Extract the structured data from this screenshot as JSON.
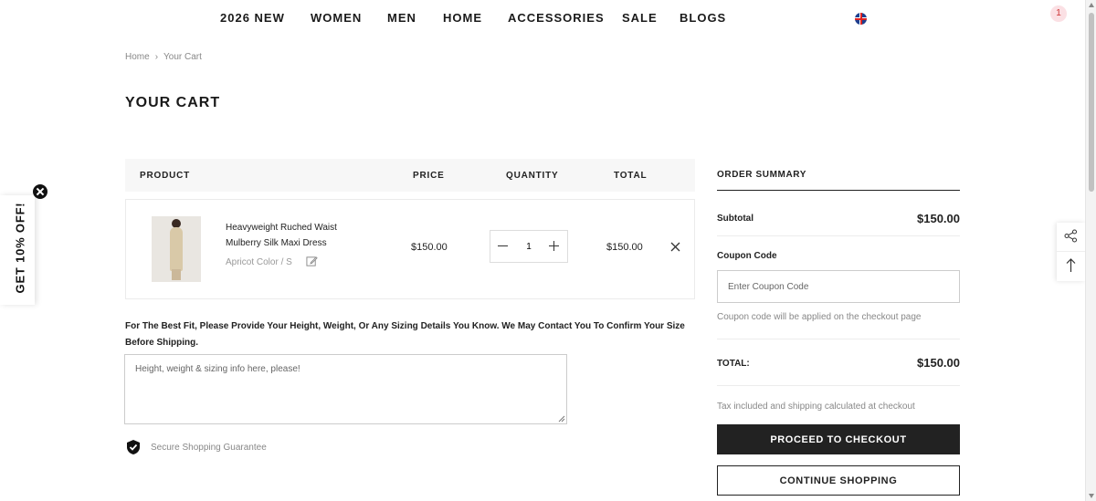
{
  "nav": {
    "items": [
      "2026 NEW",
      "WOMEN",
      "MEN",
      "HOME",
      "ACCESSORIES",
      "SALE",
      "BLOGS"
    ],
    "cart_count": "1"
  },
  "breadcrumb": {
    "home": "Home",
    "current": "Your Cart"
  },
  "page_title": "YOUR CART",
  "table": {
    "headers": {
      "product": "PRODUCT",
      "price": "PRICE",
      "quantity": "QUANTITY",
      "total": "TOTAL"
    }
  },
  "cart_item": {
    "name_line1": "Heavyweight Ruched Waist",
    "name_line2": "Mulberry Silk Maxi Dress",
    "variant": "Apricot Color / S",
    "price": "$150.00",
    "quantity": "1",
    "total": "$150.00"
  },
  "sizing": {
    "note": "For The Best Fit, Please Provide Your Height, Weight, Or Any Sizing Details You Know. We May Contact You To Confirm Your Size Before Shipping.",
    "placeholder": "Height, weight & sizing info here, please!"
  },
  "secure_text": "Secure Shopping Guarantee",
  "summary": {
    "title": "ORDER SUMMARY",
    "subtotal_label": "Subtotal",
    "subtotal_value": "$150.00",
    "coupon_label": "Coupon Code",
    "coupon_placeholder": "Enter Coupon Code",
    "coupon_note": "Coupon code will be applied on the checkout page",
    "total_label": "TOTAL:",
    "total_value": "$150.00",
    "tax_note": "Tax included and shipping calculated at checkout",
    "checkout_label": "PROCEED TO CHECKOUT",
    "continue_label": "CONTINUE SHOPPING"
  },
  "promo": {
    "label": "GET 10% OFF!"
  },
  "colors": {
    "primary": "#222222",
    "badge_bg": "#fbe0e4",
    "muted": "#888888"
  }
}
